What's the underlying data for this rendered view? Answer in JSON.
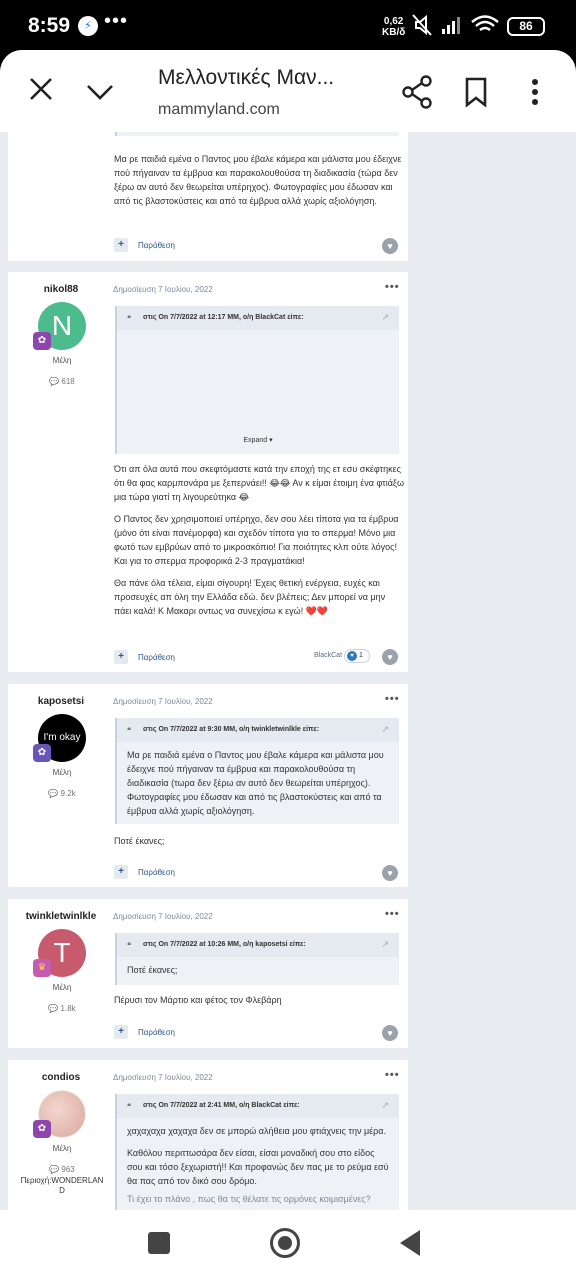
{
  "status_bar": {
    "time": "8:59",
    "messenger_icon": "messenger-icon",
    "more_dots": "•••",
    "speed_value": "0,62",
    "speed_unit": "KB/δ",
    "battery": "86"
  },
  "header": {
    "title": "Μελλοντικές Μαν...",
    "url": "mammyland.com"
  },
  "posts": [
    {
      "text": "Μα ρε παιδιά εμένα ο Παντος μου έβαλε κάμερα και μάλιστα μου έδειχνε πού πήγαιναν τα έμβρυα και παρακολουθούσα τη διαδικασία (τώρα δεν ξέρω αν αυτό δεν θεωρείται υπέρηχος). Φωτογραφίες μου έδωσαν και από τις βλαστοκύστεις και από τα έμβρυα αλλά χωρίς αξιολόγηση.",
      "quote_action": "Παράθεση"
    },
    {
      "author": "nikol88",
      "avatar_letter": "N",
      "role": "Μέλη",
      "posts_count": "618",
      "date": "Δημοσίευση 7 Ιουλίου, 2022",
      "quote_header": "στις On 7/7/2022 at 12:17 MM, ο/η BlackCat είπε:",
      "expand": "Expand",
      "paragraphs": [
        "Ότι απ όλα αυτά που σκεφτόμαστε κατά την εποχή της ετ εσυ σκέφτηκες ότι θα φας καρμπονάρα με ξεπερνάει!! 😂😂 Αν κ είμαι έτοιμη ένα φτιάξω μια τώρα γιατί τη λιγουρεύτηκα 😂",
        "Ο Παντος δεν χρησιμοποιεί υπέρηχο, δεν σου λέει τίποτα για τα έμβρυα (μόνο ότι είναι πανέμορφα) και σχεδόν τίποτα για το σπερμα! Μόνο μια φωτό των εμβρύων από το μικροσκόπιο! Για ποιότητες κλπ ούτε λόγος! Και για το σπερμα προφορικά 2-3 πραγματάκια!",
        "Θα πάνε όλα τέλεια, είμαι σίγουρη! Έχεις θετική ενέργεια, ευχές και προσευχές απ όλη την Ελλάδα εδώ. δεν βλέπεις; Δεν μπορεί να μην πάει καλά! Κ Μακαρι οντως να συνεχίσω κ εγώ! ❤️❤️"
      ],
      "quote_action": "Παράθεση",
      "reaction_user": "BlackCat",
      "reaction_count": "1"
    },
    {
      "author": "kaposetsi",
      "avatar_text": "I'm okay",
      "role": "Μέλη",
      "posts_count": "9.2k",
      "date": "Δημοσίευση 7 Ιουλίου, 2022",
      "quote_header": "στις On 7/7/2022 at 9:30 MM, ο/η twinkletwinlkle είπε:",
      "quote_text": "Μα ρε παιδιά εμένα ο Παντος μου έβαλε κάμερα και μάλιστα μου έδειχνε πού πήγαιναν τα έμβρυα και παρακολουθούσα τη διαδικασία (τωρα δεν ξέρω αν αυτό δεν θεωρείται υπέρηχος). Φωτογραφίες μου έδωσαν και από τις βλαστοκύστεις και από τα έμβρυα αλλά χωρίς αξιολόγηση.",
      "text": "Ποτέ έκανες;",
      "quote_action": "Παράθεση"
    },
    {
      "author": "twinkletwinlkle",
      "avatar_letter": "T",
      "role": "Μέλη",
      "posts_count": "1.8k",
      "date": "Δημοσίευση 7 Ιουλίου, 2022",
      "quote_header": "στις On 7/7/2022 at 10:26 MM, ο/η kaposetsi είπε:",
      "quote_text": "Ποτέ έκανες;",
      "text": "Πέρυσι τον Μάρτιο και φέτος τον Φλεβάρη",
      "quote_action": "Παράθεση"
    },
    {
      "author": "condios",
      "role": "Μέλη",
      "posts_count": "963",
      "location_line1": "Περιοχή:WONDERLAN",
      "location_line2": "D",
      "date": "Δημοσίευση 7 Ιουλίου, 2022",
      "quote_header": "στις On 7/7/2022 at 2:41 MM, ο/η BlackCat είπε:",
      "quote_p1": "χαχαχαχα χαχαχα δεν σε μπορώ αλήθεια μου φτιάχνεις την μέρα.",
      "quote_p2": "Καθόλου περιττωσάρα δεν είσαι, είσαι μοναδική σου στο είδος σου και τόσο ξεχωριστή!! Και προφανώς δεν πας με το ρεύμα εσύ θα πας από τον δικό σου δρόμο.",
      "quote_p3": "Τι έχει το πλάνο , πως θα τις θέλατε τις ορμόνες κοιμισμένες?"
    }
  ],
  "colors": {
    "page_bg": "#e9ecf0",
    "link": "#2f5a84",
    "badge": "#8e45ad",
    "avatar_n": "#4cbb8e",
    "avatar_t": "#c85a6e"
  }
}
